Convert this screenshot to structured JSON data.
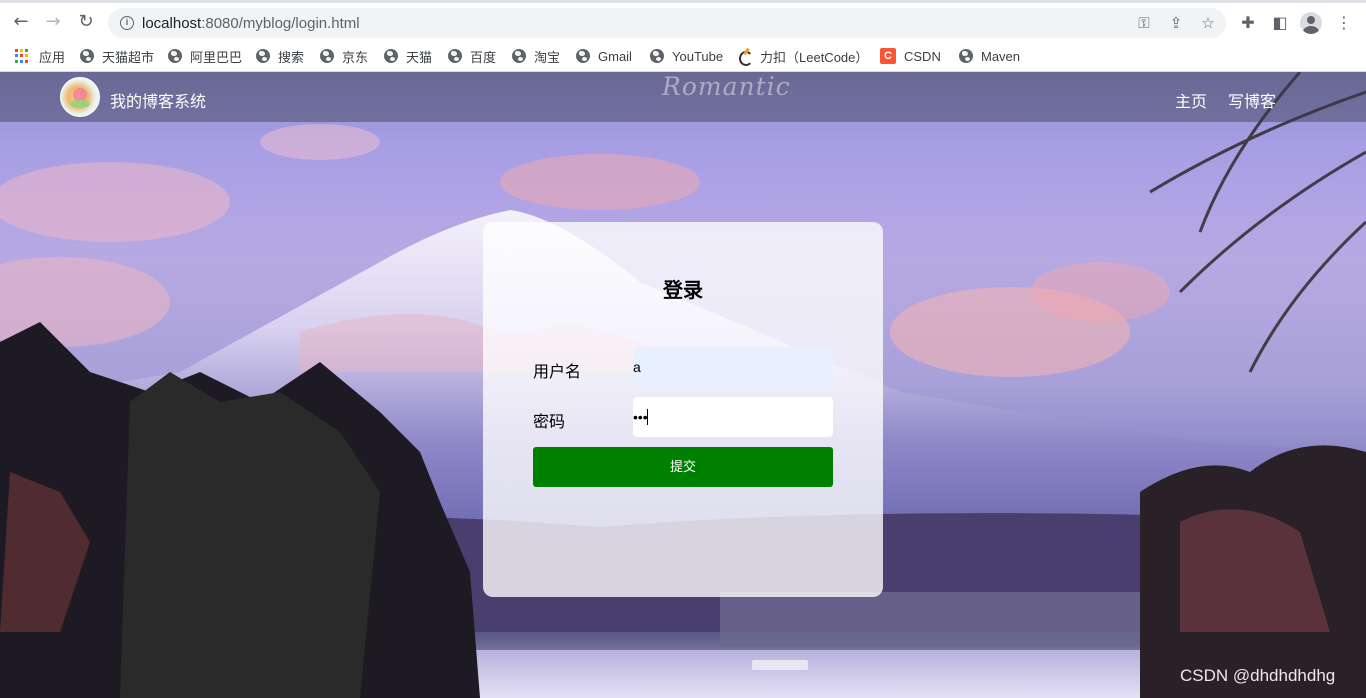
{
  "browser": {
    "url_host": "localhost",
    "url_rest": ":8080/myblog/login.html",
    "nav_icons": {
      "back": "back-arrow-icon",
      "forward": "forward-arrow-icon",
      "reload": "reload-icon",
      "info": "site-info-icon"
    },
    "omnibox_icons": [
      "key-icon",
      "share-icon",
      "star-icon"
    ],
    "toolbar_icons": [
      "extensions-icon",
      "side-panel-icon",
      "profile-icon",
      "menu-icon"
    ]
  },
  "bookmarks": {
    "apps": "应用",
    "items": [
      "天猫超市",
      "阿里巴巴",
      "搜索",
      "京东",
      "天猫",
      "百度",
      "淘宝",
      "Gmail",
      "YouTube",
      "力扣（LeetCode）",
      "CSDN",
      "Maven"
    ]
  },
  "site": {
    "title": "我的博客系统",
    "banner_text": "Romantic",
    "nav_links": [
      "主页",
      "写博客"
    ]
  },
  "login": {
    "title": "登录",
    "username_label": "用户名",
    "username_value": "a",
    "password_label": "密码",
    "password_value": "•••",
    "submit_label": "提交"
  },
  "watermark": "CSDN @dhdhdhdhg",
  "colors": {
    "submit_button": "#008000",
    "autofill_input": "#e8f0fe",
    "nav_overlay": "rgba(60,60,80,0.45)"
  }
}
